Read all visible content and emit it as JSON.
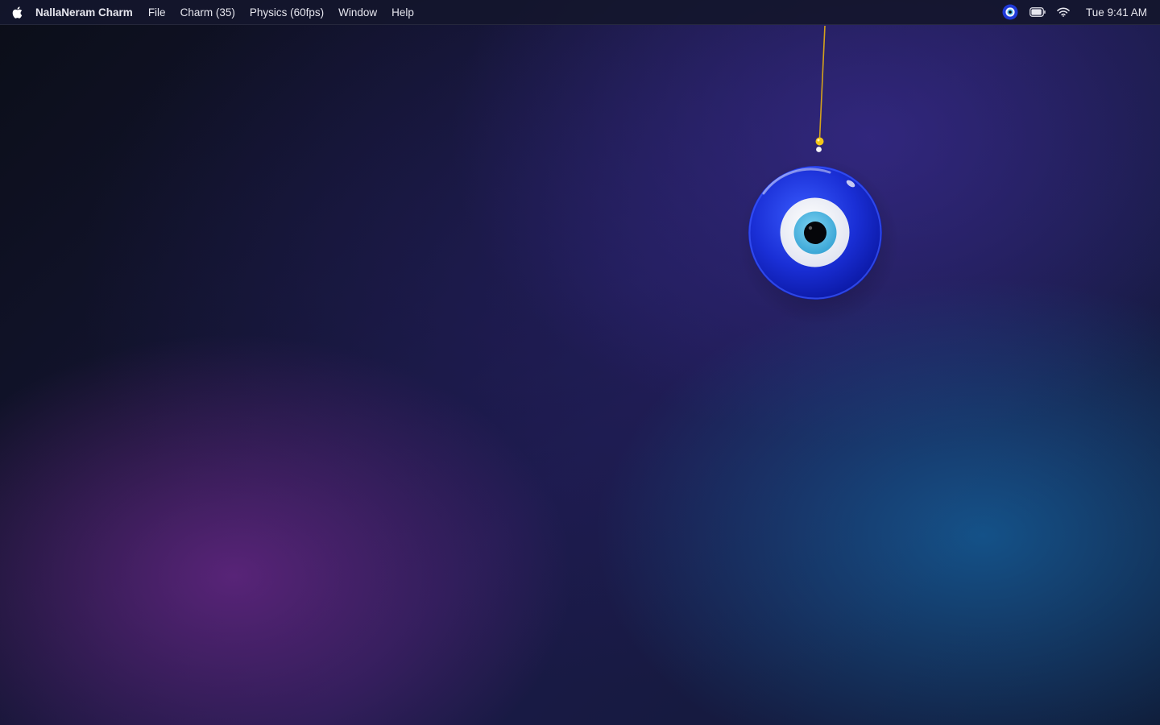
{
  "menubar": {
    "apple_icon": "apple-logo-icon",
    "app_name": "NallaNeram Charm",
    "items": [
      {
        "label": "File"
      },
      {
        "label": "Charm (35)"
      },
      {
        "label": "Physics (60fps)"
      },
      {
        "label": "Window"
      },
      {
        "label": "Help"
      }
    ],
    "status": {
      "charm_icon": "evil-eye-icon",
      "battery_icon": "battery-icon",
      "wifi_icon": "wifi-icon",
      "clock": "Tue 9:41 AM"
    }
  },
  "charm": {
    "type": "evil-eye-charm",
    "colors": {
      "outer_blue": "#1a2fd6",
      "white_ring": "#f2f4fa",
      "iris": "#4fb6e0",
      "pupil": "#05060a",
      "string": "#d4a21c",
      "bead": "#f2c618"
    }
  }
}
